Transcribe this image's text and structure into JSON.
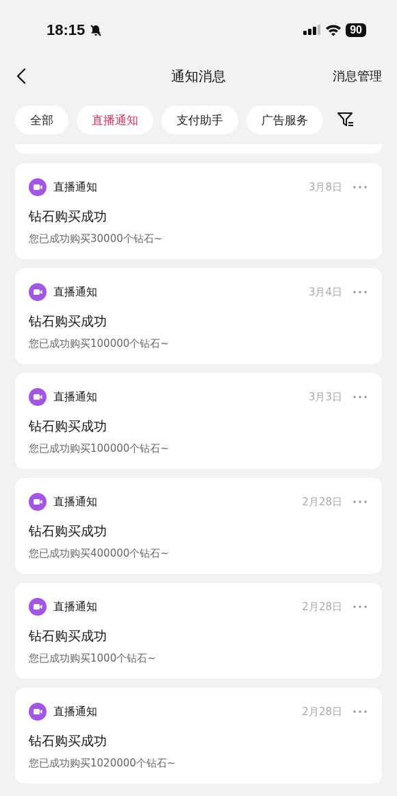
{
  "status_bar": {
    "time": "18:15",
    "battery": "90"
  },
  "nav": {
    "title": "通知消息",
    "action": "消息管理"
  },
  "tabs": [
    {
      "label": "全部",
      "selected": false
    },
    {
      "label": "直播通知",
      "selected": true
    },
    {
      "label": "支付助手",
      "selected": false
    },
    {
      "label": "广告服务",
      "selected": false
    }
  ],
  "notifications": [
    {
      "source": "直播通知",
      "date": "3月8日",
      "title": "钻石购买成功",
      "body": "您已成功购买30000个钻石~"
    },
    {
      "source": "直播通知",
      "date": "3月4日",
      "title": "钻石购买成功",
      "body": "您已成功购买100000个钻石~"
    },
    {
      "source": "直播通知",
      "date": "3月3日",
      "title": "钻石购买成功",
      "body": "您已成功购买100000个钻石~"
    },
    {
      "source": "直播通知",
      "date": "2月28日",
      "title": "钻石购买成功",
      "body": "您已成功购买400000个钻石~"
    },
    {
      "source": "直播通知",
      "date": "2月28日",
      "title": "钻石购买成功",
      "body": "您已成功购买1000个钻石~"
    },
    {
      "source": "直播通知",
      "date": "2月28日",
      "title": "钻石购买成功",
      "body": "您已成功购买1020000个钻石~"
    }
  ]
}
